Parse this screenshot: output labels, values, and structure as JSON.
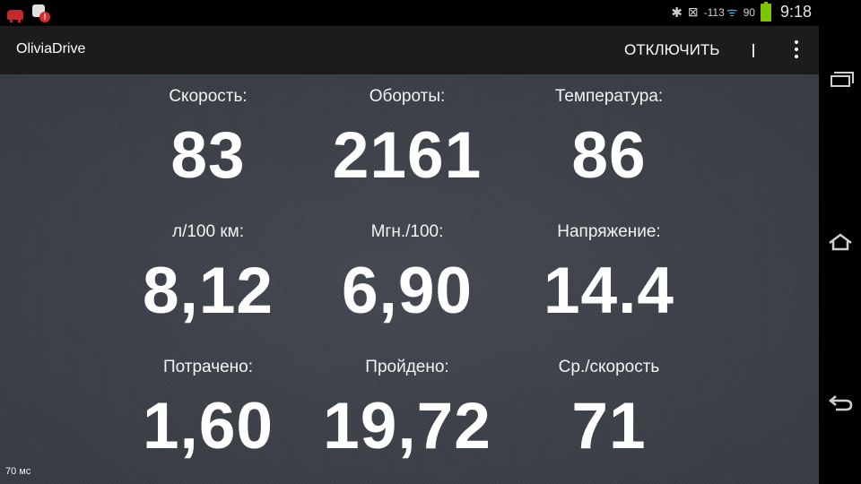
{
  "status_bar": {
    "signal_text": "-113",
    "battery_level": "90",
    "time": "9:18"
  },
  "action_bar": {
    "title": "OliviaDrive",
    "disconnect_label": "ОТКЛЮЧИТЬ"
  },
  "gauges": [
    {
      "label": "Скорость:",
      "value": "83"
    },
    {
      "label": "Обороты:",
      "value": "2161"
    },
    {
      "label": "Температура:",
      "value": "86"
    },
    {
      "label": "л/100 км:",
      "value": "8,12"
    },
    {
      "label": "Мгн./100:",
      "value": "6,90"
    },
    {
      "label": "Напряжение:",
      "value": "14.4"
    },
    {
      "label": "Потрачено:",
      "value": "1,60"
    },
    {
      "label": "Пройдено:",
      "value": "19,72"
    },
    {
      "label": "Ср./скорость",
      "value": "71"
    }
  ],
  "footer": {
    "latency": "70 мс"
  },
  "icons": {
    "status_left": [
      "car-notification-icon",
      "app-notification-icon"
    ],
    "status_right": [
      "bluetooth-icon",
      "vibrate-mute-icon",
      "wifi-icon",
      "battery-icon"
    ],
    "nav": [
      "recents-icon",
      "home-icon",
      "back-icon"
    ]
  },
  "colors": {
    "content_background": "#3b4048",
    "action_bar": "#1c1c1c",
    "battery": "#7cc400",
    "wifi_accent": "#33b5e5",
    "notification_red": "#c62828"
  }
}
